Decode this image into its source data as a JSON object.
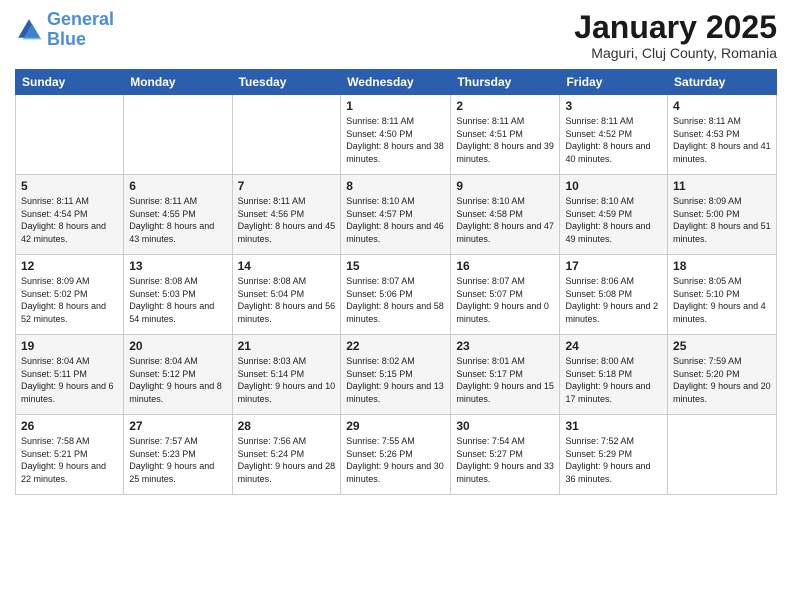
{
  "logo": {
    "line1": "General",
    "line2": "Blue"
  },
  "title": "January 2025",
  "subtitle": "Maguri, Cluj County, Romania",
  "days_of_week": [
    "Sunday",
    "Monday",
    "Tuesday",
    "Wednesday",
    "Thursday",
    "Friday",
    "Saturday"
  ],
  "weeks": [
    [
      {
        "day": "",
        "sunrise": "",
        "sunset": "",
        "daylight": ""
      },
      {
        "day": "",
        "sunrise": "",
        "sunset": "",
        "daylight": ""
      },
      {
        "day": "",
        "sunrise": "",
        "sunset": "",
        "daylight": ""
      },
      {
        "day": "1",
        "sunrise": "Sunrise: 8:11 AM",
        "sunset": "Sunset: 4:50 PM",
        "daylight": "Daylight: 8 hours and 38 minutes."
      },
      {
        "day": "2",
        "sunrise": "Sunrise: 8:11 AM",
        "sunset": "Sunset: 4:51 PM",
        "daylight": "Daylight: 8 hours and 39 minutes."
      },
      {
        "day": "3",
        "sunrise": "Sunrise: 8:11 AM",
        "sunset": "Sunset: 4:52 PM",
        "daylight": "Daylight: 8 hours and 40 minutes."
      },
      {
        "day": "4",
        "sunrise": "Sunrise: 8:11 AM",
        "sunset": "Sunset: 4:53 PM",
        "daylight": "Daylight: 8 hours and 41 minutes."
      }
    ],
    [
      {
        "day": "5",
        "sunrise": "Sunrise: 8:11 AM",
        "sunset": "Sunset: 4:54 PM",
        "daylight": "Daylight: 8 hours and 42 minutes."
      },
      {
        "day": "6",
        "sunrise": "Sunrise: 8:11 AM",
        "sunset": "Sunset: 4:55 PM",
        "daylight": "Daylight: 8 hours and 43 minutes."
      },
      {
        "day": "7",
        "sunrise": "Sunrise: 8:11 AM",
        "sunset": "Sunset: 4:56 PM",
        "daylight": "Daylight: 8 hours and 45 minutes."
      },
      {
        "day": "8",
        "sunrise": "Sunrise: 8:10 AM",
        "sunset": "Sunset: 4:57 PM",
        "daylight": "Daylight: 8 hours and 46 minutes."
      },
      {
        "day": "9",
        "sunrise": "Sunrise: 8:10 AM",
        "sunset": "Sunset: 4:58 PM",
        "daylight": "Daylight: 8 hours and 47 minutes."
      },
      {
        "day": "10",
        "sunrise": "Sunrise: 8:10 AM",
        "sunset": "Sunset: 4:59 PM",
        "daylight": "Daylight: 8 hours and 49 minutes."
      },
      {
        "day": "11",
        "sunrise": "Sunrise: 8:09 AM",
        "sunset": "Sunset: 5:00 PM",
        "daylight": "Daylight: 8 hours and 51 minutes."
      }
    ],
    [
      {
        "day": "12",
        "sunrise": "Sunrise: 8:09 AM",
        "sunset": "Sunset: 5:02 PM",
        "daylight": "Daylight: 8 hours and 52 minutes."
      },
      {
        "day": "13",
        "sunrise": "Sunrise: 8:08 AM",
        "sunset": "Sunset: 5:03 PM",
        "daylight": "Daylight: 8 hours and 54 minutes."
      },
      {
        "day": "14",
        "sunrise": "Sunrise: 8:08 AM",
        "sunset": "Sunset: 5:04 PM",
        "daylight": "Daylight: 8 hours and 56 minutes."
      },
      {
        "day": "15",
        "sunrise": "Sunrise: 8:07 AM",
        "sunset": "Sunset: 5:06 PM",
        "daylight": "Daylight: 8 hours and 58 minutes."
      },
      {
        "day": "16",
        "sunrise": "Sunrise: 8:07 AM",
        "sunset": "Sunset: 5:07 PM",
        "daylight": "Daylight: 9 hours and 0 minutes."
      },
      {
        "day": "17",
        "sunrise": "Sunrise: 8:06 AM",
        "sunset": "Sunset: 5:08 PM",
        "daylight": "Daylight: 9 hours and 2 minutes."
      },
      {
        "day": "18",
        "sunrise": "Sunrise: 8:05 AM",
        "sunset": "Sunset: 5:10 PM",
        "daylight": "Daylight: 9 hours and 4 minutes."
      }
    ],
    [
      {
        "day": "19",
        "sunrise": "Sunrise: 8:04 AM",
        "sunset": "Sunset: 5:11 PM",
        "daylight": "Daylight: 9 hours and 6 minutes."
      },
      {
        "day": "20",
        "sunrise": "Sunrise: 8:04 AM",
        "sunset": "Sunset: 5:12 PM",
        "daylight": "Daylight: 9 hours and 8 minutes."
      },
      {
        "day": "21",
        "sunrise": "Sunrise: 8:03 AM",
        "sunset": "Sunset: 5:14 PM",
        "daylight": "Daylight: 9 hours and 10 minutes."
      },
      {
        "day": "22",
        "sunrise": "Sunrise: 8:02 AM",
        "sunset": "Sunset: 5:15 PM",
        "daylight": "Daylight: 9 hours and 13 minutes."
      },
      {
        "day": "23",
        "sunrise": "Sunrise: 8:01 AM",
        "sunset": "Sunset: 5:17 PM",
        "daylight": "Daylight: 9 hours and 15 minutes."
      },
      {
        "day": "24",
        "sunrise": "Sunrise: 8:00 AM",
        "sunset": "Sunset: 5:18 PM",
        "daylight": "Daylight: 9 hours and 17 minutes."
      },
      {
        "day": "25",
        "sunrise": "Sunrise: 7:59 AM",
        "sunset": "Sunset: 5:20 PM",
        "daylight": "Daylight: 9 hours and 20 minutes."
      }
    ],
    [
      {
        "day": "26",
        "sunrise": "Sunrise: 7:58 AM",
        "sunset": "Sunset: 5:21 PM",
        "daylight": "Daylight: 9 hours and 22 minutes."
      },
      {
        "day": "27",
        "sunrise": "Sunrise: 7:57 AM",
        "sunset": "Sunset: 5:23 PM",
        "daylight": "Daylight: 9 hours and 25 minutes."
      },
      {
        "day": "28",
        "sunrise": "Sunrise: 7:56 AM",
        "sunset": "Sunset: 5:24 PM",
        "daylight": "Daylight: 9 hours and 28 minutes."
      },
      {
        "day": "29",
        "sunrise": "Sunrise: 7:55 AM",
        "sunset": "Sunset: 5:26 PM",
        "daylight": "Daylight: 9 hours and 30 minutes."
      },
      {
        "day": "30",
        "sunrise": "Sunrise: 7:54 AM",
        "sunset": "Sunset: 5:27 PM",
        "daylight": "Daylight: 9 hours and 33 minutes."
      },
      {
        "day": "31",
        "sunrise": "Sunrise: 7:52 AM",
        "sunset": "Sunset: 5:29 PM",
        "daylight": "Daylight: 9 hours and 36 minutes."
      },
      {
        "day": "",
        "sunrise": "",
        "sunset": "",
        "daylight": ""
      }
    ]
  ]
}
